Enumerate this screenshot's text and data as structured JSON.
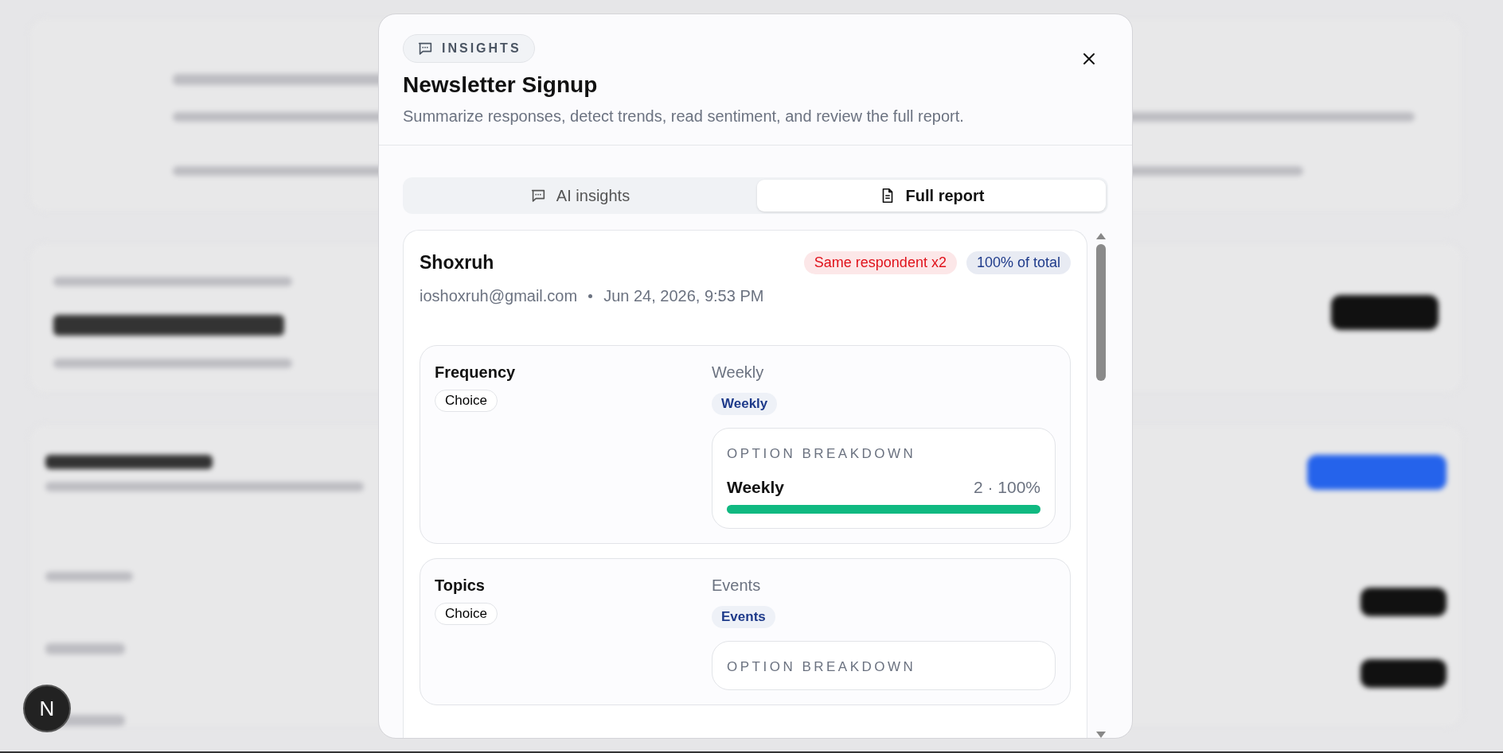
{
  "dialog": {
    "badge": "INSIGHTS",
    "title": "Newsletter Signup",
    "subtitle": "Summarize responses, detect trends, read sentiment, and review the full report."
  },
  "tabs": [
    {
      "label": "AI insights",
      "selected": false,
      "kind": "chat"
    },
    {
      "label": "Full report",
      "selected": true,
      "kind": "document"
    }
  ],
  "report": {
    "name": "Shoxruh",
    "tags": [
      {
        "label": "Same respondent x2",
        "color": "#e0121b"
      },
      {
        "label": "100% of total",
        "color": "#1e3a8a"
      }
    ],
    "email": "ioshoxruh@gmail.com",
    "date": "Jun 24, 2026, 9:53 PM",
    "questions": [
      {
        "label": "Frequency",
        "type": "Choice",
        "answer": "Weekly",
        "chips": [
          "Weekly"
        ],
        "breakdown_title": "OPTION BREAKDOWN",
        "options": [
          {
            "label": "Weekly",
            "reading": "2 · 100%",
            "level": 1
          }
        ]
      },
      {
        "label": "Topics",
        "type": "Choice",
        "answer": "Events",
        "chips": [
          "Events"
        ],
        "breakdown_title": "OPTION BREAKDOWN"
      }
    ]
  },
  "dev_badge": "N"
}
